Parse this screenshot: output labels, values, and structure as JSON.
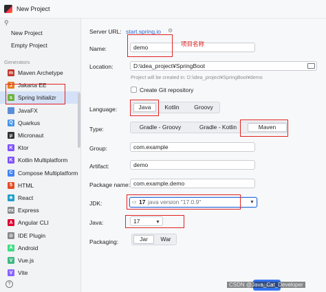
{
  "window": {
    "title": "New Project"
  },
  "sidebar": {
    "top_items": [
      {
        "label": "New Project"
      },
      {
        "label": "Empty Project"
      }
    ],
    "section_label": "Generators",
    "generators": [
      {
        "label": "Maven Archetype",
        "icon": "maven-icon",
        "color": "#c0392b",
        "glyph": "m"
      },
      {
        "label": "Jakarta EE",
        "icon": "jakarta-ee-icon",
        "color": "#e67e22",
        "glyph": "J"
      },
      {
        "label": "Spring Initializr",
        "icon": "spring-icon",
        "color": "#6db33f",
        "glyph": "s"
      },
      {
        "label": "JavaFX",
        "icon": "javafx-icon",
        "color": "#5b8dd6",
        "glyph": ""
      },
      {
        "label": "Quarkus",
        "icon": "quarkus-icon",
        "color": "#4695eb",
        "glyph": "Q"
      },
      {
        "label": "Micronaut",
        "icon": "micronaut-icon",
        "color": "#333333",
        "glyph": "μ"
      },
      {
        "label": "Ktor",
        "icon": "ktor-icon",
        "color": "#7f52ff",
        "glyph": "K"
      },
      {
        "label": "Kotlin Multiplatform",
        "icon": "kotlin-icon",
        "color": "#7f52ff",
        "glyph": "K"
      },
      {
        "label": "Compose Multiplatform",
        "icon": "compose-icon",
        "color": "#4285f4",
        "glyph": "C"
      },
      {
        "label": "HTML",
        "icon": "html-icon",
        "color": "#e44d26",
        "glyph": "5"
      },
      {
        "label": "React",
        "icon": "react-icon",
        "color": "#1e9ec9",
        "glyph": "⚛"
      },
      {
        "label": "Express",
        "icon": "express-icon",
        "color": "#888888",
        "glyph": "ex"
      },
      {
        "label": "Angular CLI",
        "icon": "angular-icon",
        "color": "#dd0031",
        "glyph": "A"
      },
      {
        "label": "IDE Plugin",
        "icon": "ide-plugin-icon",
        "color": "#888888",
        "glyph": "⊙"
      },
      {
        "label": "Android",
        "icon": "android-icon",
        "color": "#3ddc84",
        "glyph": "A"
      },
      {
        "label": "Vue.js",
        "icon": "vue-icon",
        "color": "#41b883",
        "glyph": "V"
      },
      {
        "label": "Vite",
        "icon": "vite-icon",
        "color": "#8a62ff",
        "glyph": "V"
      }
    ],
    "selected": "Spring Initializr"
  },
  "form": {
    "server_url_label": "Server URL:",
    "server_url_value": "start.spring.io",
    "name_label": "Name:",
    "name_value": "demo",
    "name_annotation": "项目名称",
    "location_label": "Location:",
    "location_value": "D:\\idea_project¥SpringBoot",
    "location_hint": "Project will be created in: D:\\idea_project¥SpringBoot¥demo",
    "git_label": "Create Git repository",
    "git_checked": false,
    "language_label": "Language:",
    "languages": [
      "Java",
      "Kotlin",
      "Groovy"
    ],
    "language_selected": "Java",
    "type_label": "Type:",
    "types": [
      "Gradle - Groovy",
      "Gradle - Kotlin",
      "Maven"
    ],
    "type_selected": "Maven",
    "group_label": "Group:",
    "group_value": "com.example",
    "artifact_label": "Artifact:",
    "artifact_value": "demo",
    "package_label": "Package name:",
    "package_value": "com.example.demo",
    "jdk_label": "JDK:",
    "jdk_number": "17",
    "jdk_version": "java version \"17.0.9\"",
    "java_label": "Java:",
    "java_value": "17",
    "packaging_label": "Packaging:",
    "packagings": [
      "Jar",
      "War"
    ],
    "packaging_selected": "Jar",
    "next_label": "Next",
    "watermark": "CSDN @Java_Cat_Developer"
  },
  "colors": {
    "accent": "#3574f0",
    "annotation": "#e02020",
    "selected_row": "#d5e1f6"
  }
}
